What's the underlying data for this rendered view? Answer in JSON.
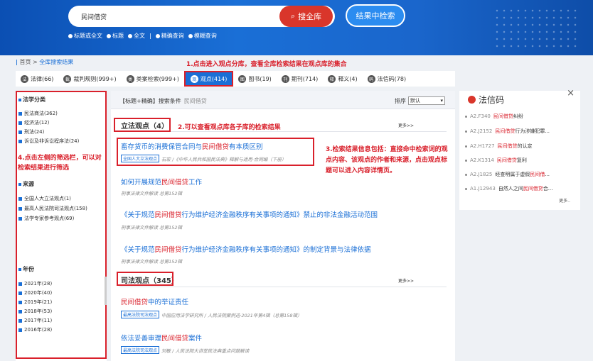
{
  "header": {
    "search_value": "民间借贷",
    "btn_search_all": "搜全库",
    "btn_search_in": "结果中检索",
    "options": [
      "标题或全文",
      "标题",
      "全文",
      "精确查询",
      "模糊查询"
    ],
    "divider": "|"
  },
  "breadcrumb": {
    "home": "首页",
    "sep": ">",
    "current": "全库搜索结果"
  },
  "annotations": {
    "a1": "1.点击进入观点分库，查看全库检索结果在观点库的集合",
    "a2": "2.可以查看观点库各子库的检索结果",
    "a3": "3.检索结果信息包括：直接命中检索词的观点内容、该观点的作者和来源，点击观点标题可以进入内容详情页。",
    "a4": "4.点击左侧的筛选栏，可以对检索结果进行筛选"
  },
  "tabs": [
    {
      "label": "法律(66)",
      "icon": "law-icon"
    },
    {
      "label": "裁判规则(999+)",
      "icon": "gavel-icon"
    },
    {
      "label": "类案检索(999+)",
      "icon": "case-icon"
    },
    {
      "label": "观点(414)",
      "icon": "viewpoint-icon",
      "active": true
    },
    {
      "label": "图书(19)",
      "icon": "book-icon"
    },
    {
      "label": "期刊(714)",
      "icon": "journal-icon"
    },
    {
      "label": "释义(4)",
      "icon": "interpretation-icon"
    },
    {
      "label": "法信码(78)",
      "icon": "code-icon"
    }
  ],
  "filters": {
    "sec1": {
      "title": "法学分类",
      "items": [
        "民法商法(362)",
        "经济法(12)",
        "刑法(24)",
        "诉讼及非诉讼程序法(24)"
      ]
    },
    "sec2": {
      "title": "来源",
      "items": [
        "全国人大立法观点(1)",
        "最高人民法院司法观点(158)",
        "法学专家参考观点(69)"
      ]
    },
    "sec3": {
      "title": "年份",
      "items": [
        "2021年(28)",
        "2020年(40)",
        "2019年(21)",
        "2018年(53)",
        "2017年(11)",
        "2016年(28)"
      ]
    }
  },
  "main": {
    "cond_label": "【标题+精确】搜索条件",
    "cond_query": "民间借贷",
    "sort_label": "排序",
    "sort_value": "默认",
    "more": "更多>>",
    "cat1": "立法观点（4）",
    "cat2": "司法观点（345）",
    "items": [
      {
        "pre": "畜存货币的消费保管合同与",
        "hl": "民间借贷",
        "post": "有本质区别",
        "badge": "全国人大立法观点",
        "meta": "石宏 /《中华人民共和国民法典》释解与适用·合同编（下册）"
      },
      {
        "pre": "如何开展规范",
        "hl": "民间借贷",
        "post": "工作",
        "meta": "刑事法律文件解读 总第152辑"
      },
      {
        "pre": "《关于规范",
        "hl": "民间借贷",
        "post": "行为维护经济金融秩序有关事项的通知》禁止的非法金融活动范围",
        "meta": "刑事法律文件解读 总第152辑"
      },
      {
        "pre": "《关于规范",
        "hl": "民间借贷",
        "post": "行为维护经济金融秩序有关事项的通知》的制定背景与法律依据",
        "meta": "刑事法律文件解读 总第152辑"
      },
      {
        "pre": "",
        "hl": "民间借贷",
        "post": "中的举证责任",
        "badge": "最高法院司法观点",
        "meta": "中国应用法学研究所 / 人民法院案例选·2021年第4辑（总第158辑）"
      },
      {
        "pre": "依法妥善审理",
        "hl": "民间借贷",
        "post": "案件",
        "badge": "最高法院司法观点",
        "meta": "刘敏 / 人民法院大讲堂民法典重点问题解读"
      }
    ]
  },
  "right": {
    "title": "法信码",
    "close": "×",
    "more": "更多..",
    "laws": [
      {
        "code": "A2.F340",
        "hl": "民间借贷",
        "post": "纠纷"
      },
      {
        "code": "A2.J2152",
        "hl": "民间借贷",
        "post": "行为涉嫌犯罪..."
      },
      {
        "code": "A2.H1727",
        "hl": "民间借贷",
        "post": "的认定"
      },
      {
        "code": "A2.K1314",
        "hl": "民间借贷",
        "post": "复利"
      },
      {
        "code": "A2.J1825",
        "pre": "经查明属于虚假",
        "hl": "民间借",
        "post": "..."
      },
      {
        "code": "A1.J12943",
        "pre": "自然人之间",
        "hl": "民间借贷",
        "post": "合..."
      }
    ]
  }
}
